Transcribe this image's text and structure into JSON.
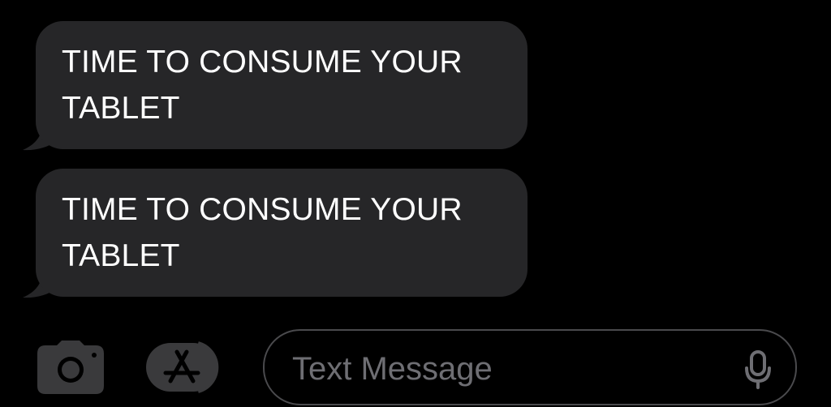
{
  "messages": [
    {
      "text": "TIME TO CONSUME YOUR TABLET",
      "direction": "received"
    },
    {
      "text": "TIME TO CONSUME YOUR TABLET",
      "direction": "received"
    }
  ],
  "composer": {
    "placeholder": "Text Message",
    "camera_icon": "camera-icon",
    "apps_icon": "app-store-icon",
    "mic_icon": "microphone-icon"
  },
  "colors": {
    "background": "#000000",
    "bubble": "#262628",
    "bubble_text": "#ffffff",
    "placeholder": "#6e6e73",
    "icon": "#3a3a3c"
  }
}
